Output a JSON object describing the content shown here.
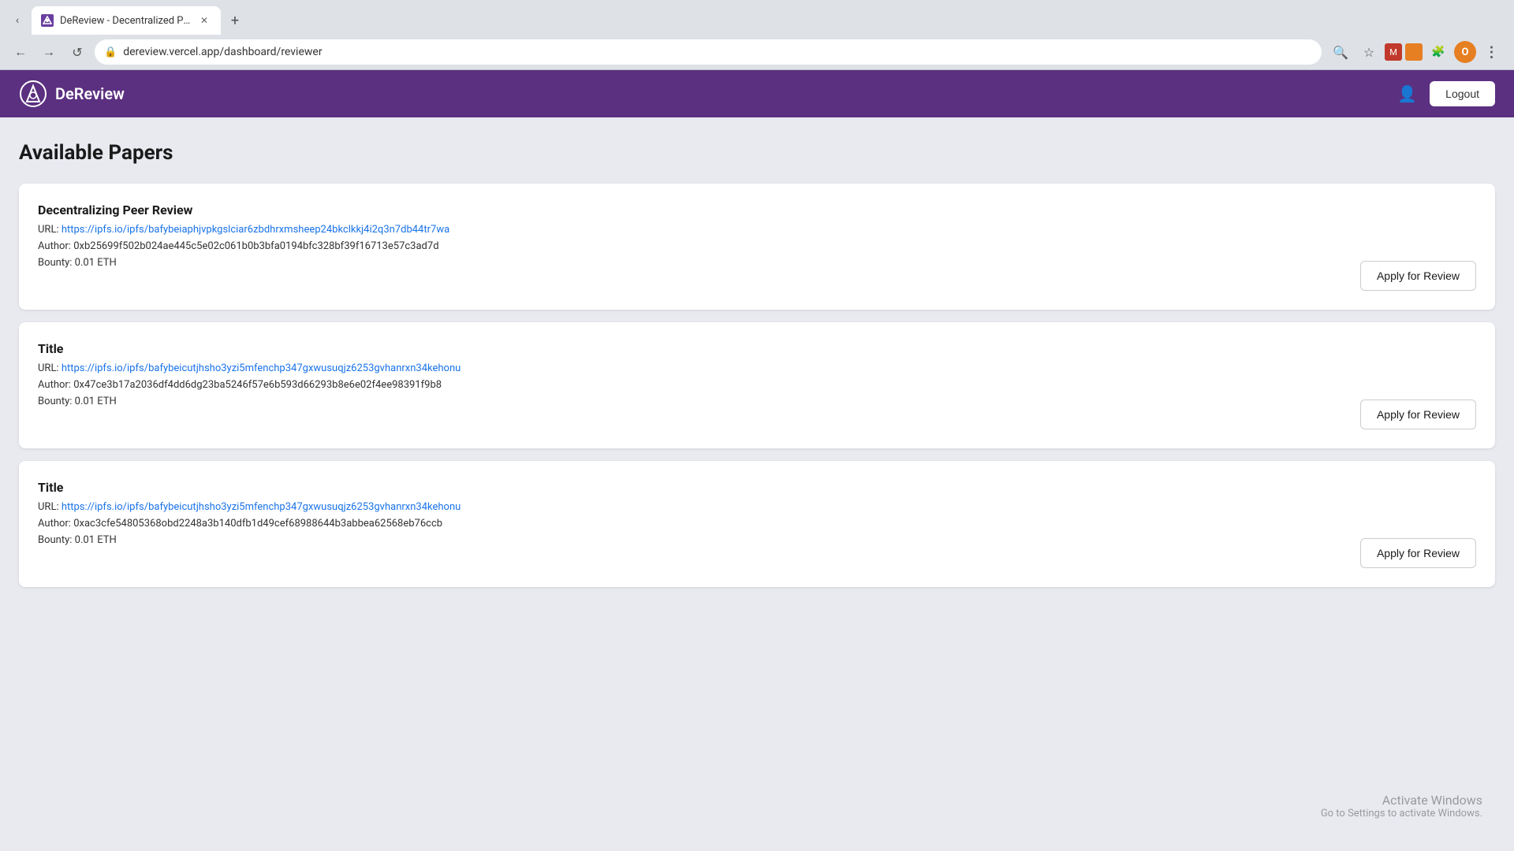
{
  "browser": {
    "tab_title": "DeReview - Decentralized Pape...",
    "url": "dereview.vercel.app/dashboard/reviewer",
    "new_tab_label": "+",
    "back_arrow": "‹",
    "forward_arrow": "›",
    "refresh_icon": "↺",
    "profile_initial": "O"
  },
  "app": {
    "logo_text": "DeReview",
    "logout_label": "Logout"
  },
  "page": {
    "title": "Available Papers"
  },
  "papers": [
    {
      "title": "Decentralizing Peer Review",
      "url_label": "URL:",
      "url": "https://ipfs.io/ipfs/bafybeiaphjvpkgslciar6zbdhrxmsheep24bkclkkj4i2q3n7db44tr7wa",
      "author_label": "Author:",
      "author": "0xb25699f502b024ae445c5e02c061b0b3bfa0194bfc328bf39f16713e57c3ad7d",
      "bounty_label": "Bounty:",
      "bounty": "0.01 ETH",
      "apply_label": "Apply for Review"
    },
    {
      "title": "Title",
      "url_label": "URL:",
      "url": "https://ipfs.io/ipfs/bafybeicutjhsho3yzi5mfenchp347gxwusuqjz6253gvhanrxn34kehonu",
      "author_label": "Author:",
      "author": "0x47ce3b17a2036df4dd6dg23ba5246f57e6b593d66293b8e6e02f4ee98391f9b8",
      "bounty_label": "Bounty:",
      "bounty": "0.01 ETH",
      "apply_label": "Apply for Review"
    },
    {
      "title": "Title",
      "url_label": "URL:",
      "url": "https://ipfs.io/ipfs/bafybeicutjhsho3yzi5mfenchp347gxwusuqjz6253gvhanrxn34kehonu",
      "author_label": "Author:",
      "author": "0xac3cfe54805368obd2248a3b140dfb1d49cef68988644b3abbea62568eb76ccb",
      "bounty_label": "Bounty:",
      "bounty": "0.01 ETH",
      "apply_label": "Apply for Review"
    }
  ],
  "windows_watermark": {
    "line1": "Activate Windows",
    "line2": "Go to Settings to activate Windows."
  }
}
